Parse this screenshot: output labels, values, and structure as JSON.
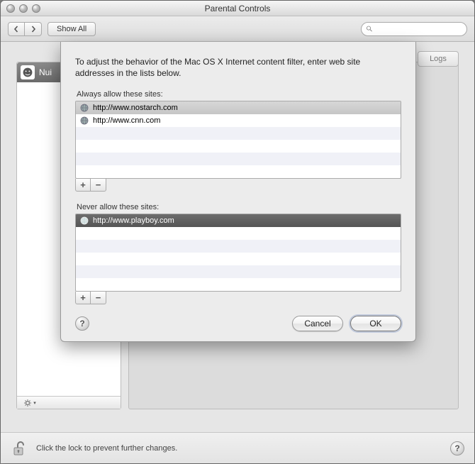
{
  "window": {
    "title": "Parental Controls",
    "toolbar": {
      "show_all": "Show All",
      "search_placeholder": ""
    }
  },
  "background": {
    "user_name": "Nui",
    "right_tab": "Logs"
  },
  "dialog": {
    "description": "To adjust the behavior of the Mac OS X Internet content filter, enter web site addresses in the lists below.",
    "allow_label": "Always allow these sites:",
    "deny_label": "Never allow these sites:",
    "allow_sites": [
      "http://www.nostarch.com",
      "http://www.cnn.com"
    ],
    "deny_sites": [
      "http://www.playboy.com"
    ],
    "add_label": "+",
    "remove_label": "−",
    "cancel": "Cancel",
    "ok": "OK"
  },
  "footer": {
    "lock_text": "Click the lock to prevent further changes."
  }
}
